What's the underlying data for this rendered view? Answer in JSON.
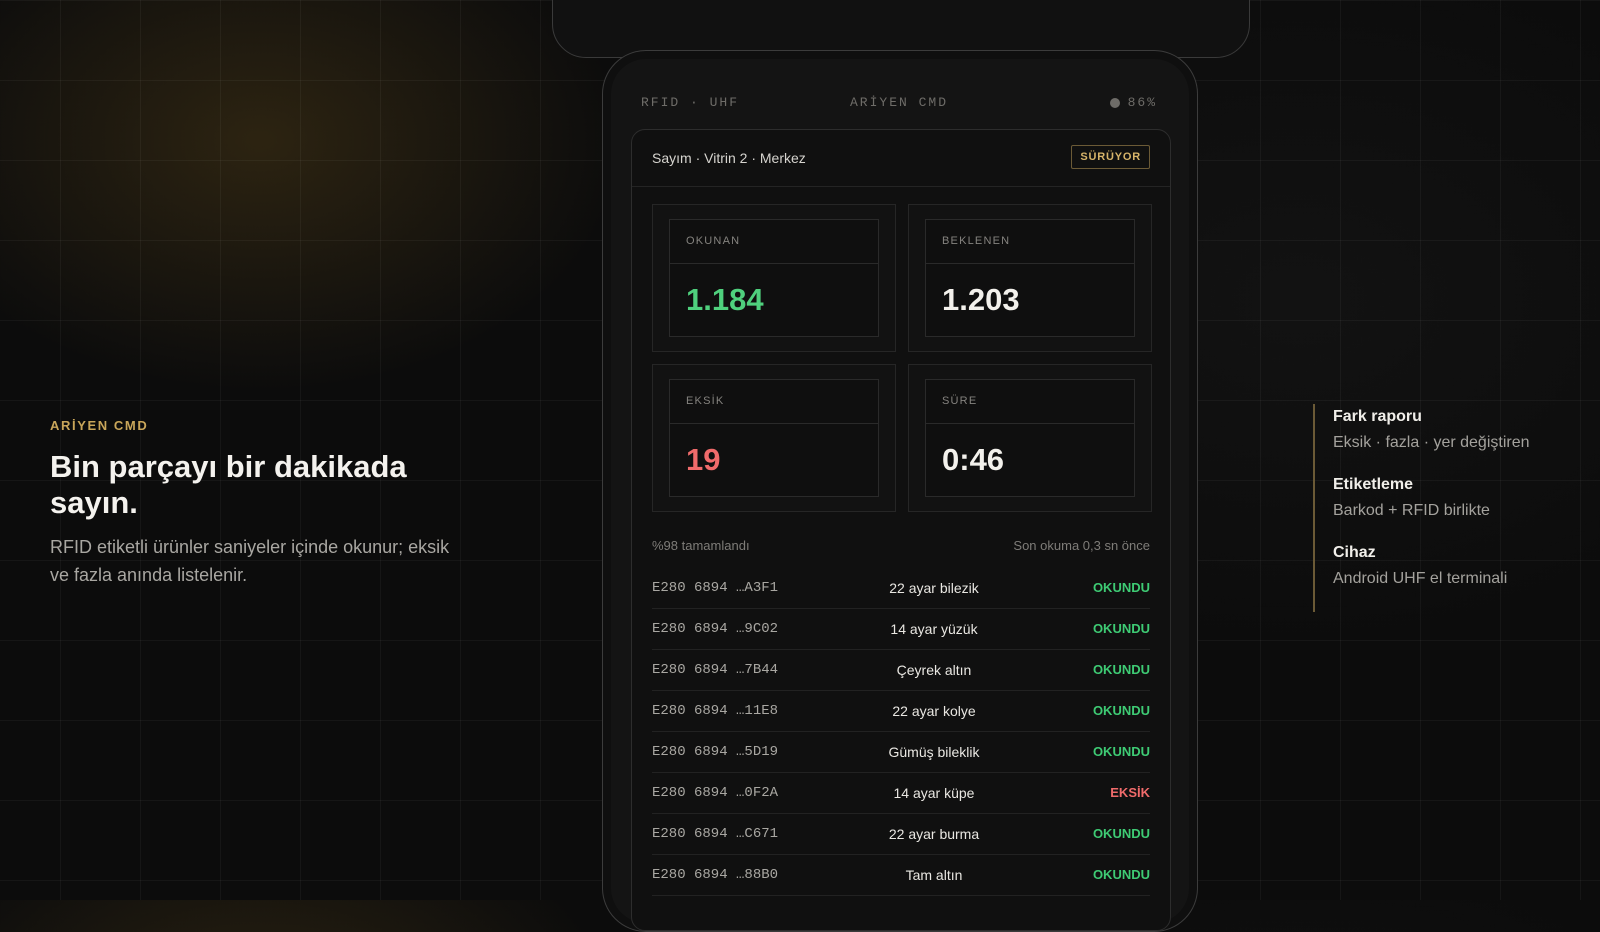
{
  "hero": {
    "eyebrow": "ARİYEN CMD",
    "headline": "Bin parçayı bir dakikada sayın.",
    "lede": "RFID etiketli ürünler saniyeler içinde okunur; eksik ve fazla anında listelenir."
  },
  "features": [
    {
      "title": "Fark raporu",
      "desc": "Eksik · fazla · yer değiştiren"
    },
    {
      "title": "Etiketleme",
      "desc": "Barkod + RFID birlikte"
    },
    {
      "title": "Cihaz",
      "desc": "Android UHF el terminali"
    }
  ],
  "device": {
    "status": {
      "left": "RFID · UHF",
      "center": "ARİYEN CMD",
      "battery": "86%"
    },
    "session_title": "Sayım · Vitrin 2 · Merkez",
    "session_badge": "SÜRÜYOR",
    "stats": {
      "read": {
        "label": "OKUNAN",
        "value": "1.184"
      },
      "expected": {
        "label": "BEKLENEN",
        "value": "1.203"
      },
      "missing": {
        "label": "EKSİK",
        "value": "19"
      },
      "duration": {
        "label": "SÜRE",
        "value": "0:46"
      }
    },
    "progress_text": "%98 tamamlandı",
    "progress_percent": 98,
    "last_read": "Son okuma 0,3 sn önce",
    "rows": [
      {
        "epc": "E280 6894 …A3F1",
        "product": "22 ayar bilezik",
        "status": "OKUNDU"
      },
      {
        "epc": "E280 6894 …9C02",
        "product": "14 ayar yüzük",
        "status": "OKUNDU"
      },
      {
        "epc": "E280 6894 …7B44",
        "product": "Çeyrek altın",
        "status": "OKUNDU"
      },
      {
        "epc": "E280 6894 …11E8",
        "product": "22 ayar kolye",
        "status": "OKUNDU"
      },
      {
        "epc": "E280 6894 …5D19",
        "product": "Gümüş bileklik",
        "status": "OKUNDU"
      },
      {
        "epc": "E280 6894 …0F2A",
        "product": "14 ayar küpe",
        "status": "EKSİK"
      },
      {
        "epc": "E280 6894 …C671",
        "product": "22 ayar burma",
        "status": "OKUNDU"
      },
      {
        "epc": "E280 6894 …88B0",
        "product": "Tam altın",
        "status": "OKUNDU"
      }
    ]
  },
  "colors": {
    "accent": "#c9a65a",
    "ok": "#3ecb74",
    "missing": "#f06b6b",
    "background": "#0c0c0c"
  },
  "icons": {
    "battery": "status-dot-icon"
  }
}
